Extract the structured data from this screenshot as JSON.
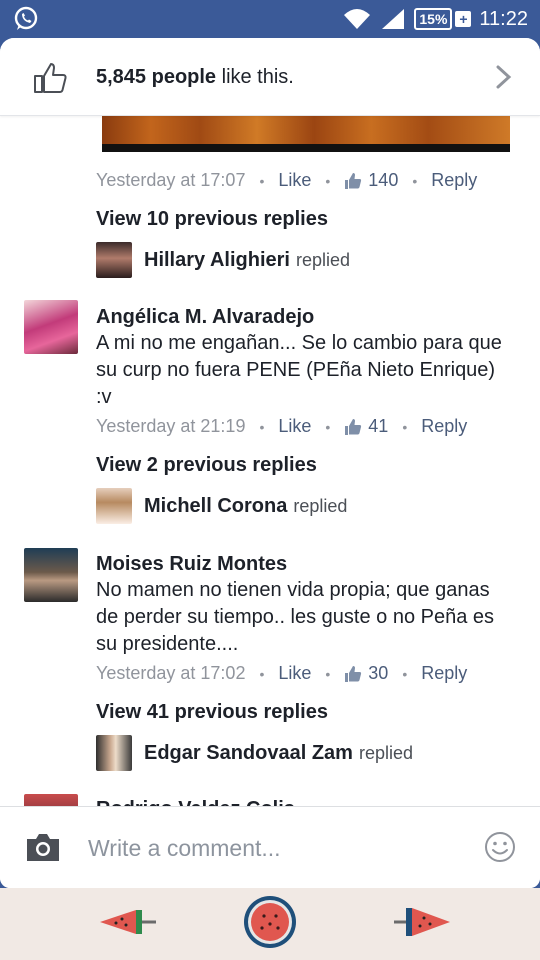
{
  "status_bar": {
    "battery": "15%",
    "time": "11:22",
    "icons": [
      "whatsapp-icon",
      "wifi-icon",
      "signal-icon",
      "battery-icon"
    ]
  },
  "likes_header": {
    "count": "5,845 people",
    "suffix": " like this."
  },
  "threads": [
    {
      "meta": {
        "time": "Yesterday at 17:07",
        "like": "Like",
        "count": "140",
        "reply": "Reply"
      },
      "previous": "View 10 previous replies",
      "replier": {
        "name": "Hillary Alighieri",
        "verb": "replied"
      }
    },
    {
      "author": "Angélica M. Alvaradejo",
      "text": "A mi no me engañan... Se lo cambio para que su curp no fuera PENE (PEña Nieto Enrique) :v",
      "meta": {
        "time": "Yesterday at 21:19",
        "like": "Like",
        "count": "41",
        "reply": "Reply"
      },
      "previous": "View 2 previous replies",
      "replier": {
        "name": "Michell Corona",
        "verb": "replied"
      }
    },
    {
      "author": "Moises Ruiz Montes",
      "text": "No mamen no tienen vida propia; que ganas de perder su tiempo.. les guste o no Peña es su presidente....",
      "meta": {
        "time": "Yesterday at 17:02",
        "like": "Like",
        "count": "30",
        "reply": "Reply"
      },
      "previous": "View 41 previous replies",
      "replier": {
        "name": "Edgar Sandovaal Zam",
        "verb": "replied"
      }
    },
    {
      "author": "Rodrigo Valdez Colis"
    }
  ],
  "composer": {
    "placeholder": "Write a comment..."
  },
  "colors": {
    "brand": "#3b5a98",
    "text": "#1d2129",
    "meta": "#90949c",
    "link": "#4b5c7a"
  }
}
